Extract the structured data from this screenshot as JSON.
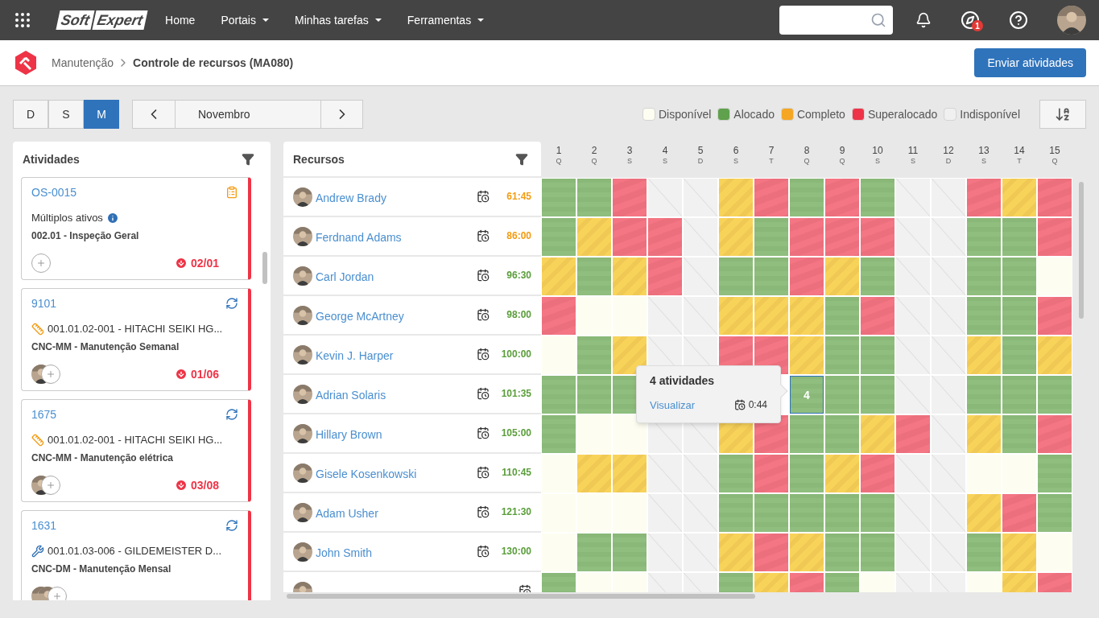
{
  "topbar": {
    "logo": {
      "left": "Soft",
      "right": "Expert"
    },
    "menu": [
      {
        "label": "Home",
        "dropdown": false
      },
      {
        "label": "Portais",
        "dropdown": true
      },
      {
        "label": "Minhas tarefas",
        "dropdown": true
      },
      {
        "label": "Ferramentas",
        "dropdown": true
      }
    ],
    "notification_badge": "1"
  },
  "breadcrumb": {
    "parent": "Manutenção",
    "current": "Controle de recursos (MA080)"
  },
  "send_button": "Enviar atividades",
  "view_toggle": [
    {
      "label": "D",
      "selected": false
    },
    {
      "label": "S",
      "selected": false
    },
    {
      "label": "M",
      "selected": true
    }
  ],
  "period": "Novembro",
  "legend": [
    {
      "label": "Disponível",
      "color": "#fdfdf1"
    },
    {
      "label": "Alocado",
      "color": "#5fa14c"
    },
    {
      "label": "Completo",
      "color": "#f5a623"
    },
    {
      "label": "Superalocado",
      "color": "#ee3346"
    },
    {
      "label": "Indisponível",
      "color": "#f0f0f0"
    }
  ],
  "activities": {
    "title": "Atividades",
    "cards": [
      {
        "id": "OS-0015",
        "kind": "inspection",
        "asset": {
          "kind": "multiple",
          "label": "Múltiplos ativos"
        },
        "subtitle": "002.01 - Inspeção Geral",
        "due": "02/01"
      },
      {
        "id": "9101",
        "kind": "recurring",
        "asset": {
          "kind": "tool",
          "label": "001.01.02-001 - HITACHI SEIKI HG..."
        },
        "subtitle": "CNC-MM - Manutenção Semanal",
        "due": "01/06"
      },
      {
        "id": "1675",
        "kind": "recurring",
        "asset": {
          "kind": "tool",
          "label": "001.01.02-001 - HITACHI SEIKI HG..."
        },
        "subtitle": "CNC-MM -  Manutenção elétrica",
        "due": "03/08"
      },
      {
        "id": "1631",
        "kind": "recurring",
        "asset": {
          "kind": "wrench",
          "label": "001.01.03-006 - GILDEMEISTER D..."
        },
        "subtitle": "CNC-DM - Manutenção Mensal"
      }
    ]
  },
  "resources": {
    "title": "Recursos",
    "days": [
      {
        "day": "1",
        "weekday": "Q"
      },
      {
        "day": "2",
        "weekday": "Q"
      },
      {
        "day": "3",
        "weekday": "S"
      },
      {
        "day": "4",
        "weekday": "S"
      },
      {
        "day": "5",
        "weekday": "D"
      },
      {
        "day": "6",
        "weekday": "S"
      },
      {
        "day": "7",
        "weekday": "T"
      },
      {
        "day": "8",
        "weekday": "Q"
      },
      {
        "day": "9",
        "weekday": "Q"
      },
      {
        "day": "10",
        "weekday": "S"
      },
      {
        "day": "11",
        "weekday": "S"
      },
      {
        "day": "12",
        "weekday": "D"
      },
      {
        "day": "13",
        "weekday": "S"
      },
      {
        "day": "14",
        "weekday": "T"
      },
      {
        "day": "15",
        "weekday": "Q"
      }
    ],
    "rows": [
      {
        "name": "Andrew Brady",
        "hours": "61:45",
        "color": "#f39c12",
        "cells": [
          {
            "kind": "alocado"
          },
          {
            "kind": "alocado"
          },
          {
            "kind": "superalocado"
          },
          {
            "kind": "indisponivel"
          },
          {
            "kind": "indisponivel"
          },
          {
            "kind": "completo"
          },
          {
            "kind": "superalocado"
          },
          {
            "kind": "alocado"
          },
          {
            "kind": "superalocado"
          },
          {
            "kind": "alocado"
          },
          {
            "kind": "indisponivel"
          },
          {
            "kind": "indisponivel"
          },
          {
            "kind": "superalocado"
          },
          {
            "kind": "completo"
          },
          {
            "kind": "superalocado"
          }
        ]
      },
      {
        "name": "Ferdnand Adams",
        "hours": "86:00",
        "color": "#f39c12",
        "cells": [
          {
            "kind": "alocado"
          },
          {
            "kind": "completo"
          },
          {
            "kind": "superalocado"
          },
          {
            "kind": "superalocado"
          },
          {
            "kind": "indisponivel"
          },
          {
            "kind": "completo"
          },
          {
            "kind": "alocado"
          },
          {
            "kind": "superalocado"
          },
          {
            "kind": "superalocado"
          },
          {
            "kind": "superalocado"
          },
          {
            "kind": "indisponivel"
          },
          {
            "kind": "indisponivel"
          },
          {
            "kind": "alocado"
          },
          {
            "kind": "alocado"
          },
          {
            "kind": "superalocado"
          }
        ]
      },
      {
        "name": "Carl Jordan",
        "hours": "96:30",
        "color": "#5a9e3a",
        "cells": [
          {
            "kind": "completo"
          },
          {
            "kind": "alocado"
          },
          {
            "kind": "completo"
          },
          {
            "kind": "superalocado"
          },
          {
            "kind": "indisponivel"
          },
          {
            "kind": "alocado"
          },
          {
            "kind": "alocado"
          },
          {
            "kind": "superalocado"
          },
          {
            "kind": "completo"
          },
          {
            "kind": "alocado"
          },
          {
            "kind": "indisponivel"
          },
          {
            "kind": "indisponivel"
          },
          {
            "kind": "alocado"
          },
          {
            "kind": "alocado"
          },
          {
            "kind": "disponivel"
          }
        ]
      },
      {
        "name": "George McArtney",
        "hours": "98:00",
        "color": "#5a9e3a",
        "cells": [
          {
            "kind": "superalocado"
          },
          {
            "kind": "disponivel"
          },
          {
            "kind": "disponivel"
          },
          {
            "kind": "indisponivel"
          },
          {
            "kind": "indisponivel"
          },
          {
            "kind": "completo"
          },
          {
            "kind": "completo"
          },
          {
            "kind": "completo"
          },
          {
            "kind": "alocado"
          },
          {
            "kind": "superalocado"
          },
          {
            "kind": "indisponivel"
          },
          {
            "kind": "indisponivel"
          },
          {
            "kind": "alocado"
          },
          {
            "kind": "alocado"
          },
          {
            "kind": "superalocado"
          }
        ]
      },
      {
        "name": "Kevin J. Harper",
        "hours": "100:00",
        "color": "#5a9e3a",
        "cells": [
          {
            "kind": "disponivel"
          },
          {
            "kind": "alocado"
          },
          {
            "kind": "completo"
          },
          {
            "kind": "indisponivel"
          },
          {
            "kind": "indisponivel"
          },
          {
            "kind": "superalocado"
          },
          {
            "kind": "superalocado"
          },
          {
            "kind": "completo"
          },
          {
            "kind": "alocado"
          },
          {
            "kind": "alocado"
          },
          {
            "kind": "indisponivel"
          },
          {
            "kind": "indisponivel"
          },
          {
            "kind": "completo"
          },
          {
            "kind": "alocado"
          },
          {
            "kind": "completo"
          }
        ]
      },
      {
        "name": "Adrian Solaris",
        "hours": "101:35",
        "color": "#5a9e3a",
        "cells": [
          {
            "kind": "alocado"
          },
          {
            "kind": "alocado"
          },
          {
            "kind": "alocado"
          },
          {
            "kind": "covered"
          },
          {
            "kind": "covered"
          },
          {
            "kind": "covered"
          },
          {
            "kind": "covered"
          },
          {
            "kind": "alocado",
            "count": "4",
            "selected": true
          },
          {
            "kind": "alocado"
          },
          {
            "kind": "alocado"
          },
          {
            "kind": "indisponivel"
          },
          {
            "kind": "indisponivel"
          },
          {
            "kind": "alocado"
          },
          {
            "kind": "alocado"
          },
          {
            "kind": "alocado"
          }
        ]
      },
      {
        "name": "Hillary Brown",
        "hours": "105:00",
        "color": "#5a9e3a",
        "cells": [
          {
            "kind": "alocado"
          },
          {
            "kind": "disponivel"
          },
          {
            "kind": "disponivel"
          },
          {
            "kind": "indisponivel"
          },
          {
            "kind": "indisponivel"
          },
          {
            "kind": "completo"
          },
          {
            "kind": "superalocado"
          },
          {
            "kind": "alocado"
          },
          {
            "kind": "alocado"
          },
          {
            "kind": "completo"
          },
          {
            "kind": "superalocado"
          },
          {
            "kind": "indisponivel"
          },
          {
            "kind": "completo"
          },
          {
            "kind": "alocado"
          },
          {
            "kind": "superalocado"
          }
        ]
      },
      {
        "name": "Gisele Kosenkowski",
        "hours": "110:45",
        "color": "#5a9e3a",
        "cells": [
          {
            "kind": "disponivel"
          },
          {
            "kind": "completo"
          },
          {
            "kind": "completo"
          },
          {
            "kind": "indisponivel"
          },
          {
            "kind": "indisponivel"
          },
          {
            "kind": "alocado"
          },
          {
            "kind": "superalocado"
          },
          {
            "kind": "alocado"
          },
          {
            "kind": "completo"
          },
          {
            "kind": "superalocado"
          },
          {
            "kind": "indisponivel"
          },
          {
            "kind": "indisponivel"
          },
          {
            "kind": "disponivel"
          },
          {
            "kind": "disponivel"
          },
          {
            "kind": "alocado"
          }
        ]
      },
      {
        "name": "Adam Usher",
        "hours": "121:30",
        "color": "#5a9e3a",
        "cells": [
          {
            "kind": "disponivel"
          },
          {
            "kind": "disponivel"
          },
          {
            "kind": "disponivel"
          },
          {
            "kind": "indisponivel"
          },
          {
            "kind": "indisponivel"
          },
          {
            "kind": "alocado"
          },
          {
            "kind": "alocado"
          },
          {
            "kind": "alocado"
          },
          {
            "kind": "alocado"
          },
          {
            "kind": "alocado"
          },
          {
            "kind": "indisponivel"
          },
          {
            "kind": "indisponivel"
          },
          {
            "kind": "completo"
          },
          {
            "kind": "superalocado"
          },
          {
            "kind": "alocado"
          }
        ]
      },
      {
        "name": "John Smith",
        "hours": "130:00",
        "color": "#5a9e3a",
        "cells": [
          {
            "kind": "disponivel"
          },
          {
            "kind": "alocado"
          },
          {
            "kind": "alocado"
          },
          {
            "kind": "indisponivel"
          },
          {
            "kind": "indisponivel"
          },
          {
            "kind": "completo"
          },
          {
            "kind": "superalocado"
          },
          {
            "kind": "completo"
          },
          {
            "kind": "alocado"
          },
          {
            "kind": "alocado"
          },
          {
            "kind": "indisponivel"
          },
          {
            "kind": "indisponivel"
          },
          {
            "kind": "alocado"
          },
          {
            "kind": "completo"
          },
          {
            "kind": "disponivel"
          }
        ]
      },
      {
        "cells": [
          {
            "kind": "alocado"
          },
          {
            "kind": "disponivel"
          },
          {
            "kind": "disponivel"
          },
          {
            "kind": "indisponivel"
          },
          {
            "kind": "indisponivel"
          },
          {
            "kind": "alocado"
          },
          {
            "kind": "completo"
          },
          {
            "kind": "superalocado"
          },
          {
            "kind": "alocado"
          },
          {
            "kind": "disponivel"
          },
          {
            "kind": "indisponivel"
          },
          {
            "kind": "indisponivel"
          },
          {
            "kind": "disponivel"
          },
          {
            "kind": "completo"
          },
          {
            "kind": "superalocado"
          }
        ]
      }
    ]
  },
  "tooltip": {
    "title": "4 atividades",
    "link": "Visualizar",
    "duration": "0:44"
  }
}
